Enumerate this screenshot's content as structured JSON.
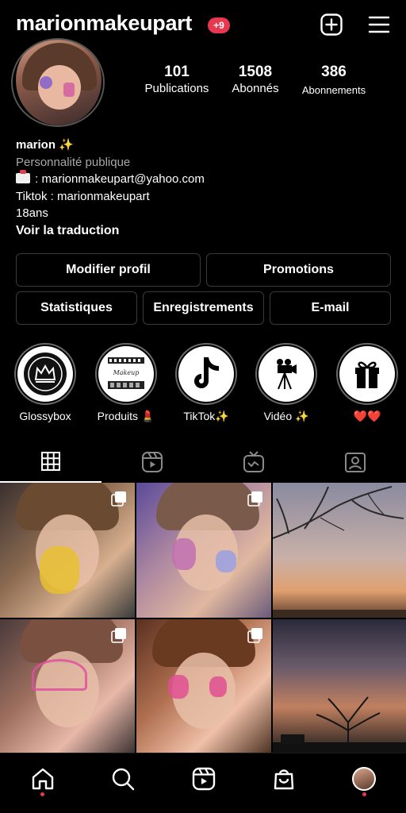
{
  "header": {
    "username": "marionmakeupart",
    "notification_badge": "+9",
    "icons": [
      "add-post-icon",
      "menu-icon"
    ]
  },
  "stats": {
    "posts": {
      "value": "101",
      "label": "Publications"
    },
    "followers": {
      "value": "1508",
      "label": "Abonnés"
    },
    "following": {
      "value": "386",
      "label": "Abonnements"
    }
  },
  "bio": {
    "name": "marion ✨",
    "category": "Personnalité publique",
    "email_line": ": marionmakeupart@yahoo.com",
    "tiktok_line": "Tiktok : marionmakeupart",
    "age_line": "18ans",
    "translate_link": "Voir la traduction"
  },
  "buttons": {
    "edit_profile": "Modifier profil",
    "promotions": "Promotions",
    "insights": "Statistiques",
    "saved": "Enregistrements",
    "email": "E-mail"
  },
  "highlights": [
    {
      "label": "Glossybox",
      "icon": "crown-logo-icon"
    },
    {
      "label": "Produits 💄",
      "icon": "makeup-shelf-icon"
    },
    {
      "label": "TikTok✨",
      "icon": "tiktok-icon"
    },
    {
      "label": "Vidéo ✨",
      "icon": "video-camera-icon"
    },
    {
      "label": "❤️❤️",
      "icon": "gift-icon"
    }
  ],
  "profile_tabs": [
    {
      "name": "grid",
      "icon": "grid-icon",
      "active": true
    },
    {
      "name": "reels",
      "icon": "reels-icon",
      "active": false
    },
    {
      "name": "igtv",
      "icon": "igtv-icon",
      "active": false
    },
    {
      "name": "tagged",
      "icon": "tagged-icon",
      "active": false
    }
  ],
  "posts": [
    {
      "subject": "makeup portrait, yellow face paint",
      "multi": true
    },
    {
      "subject": "makeup portrait, blue eye art",
      "multi": true
    },
    {
      "subject": "sunset with bare tree branches",
      "multi": false
    },
    {
      "subject": "makeup portrait, pink heart art",
      "multi": true
    },
    {
      "subject": "makeup portrait, pink hearts",
      "multi": true
    },
    {
      "subject": "sunset with bare tree silhouette",
      "multi": false
    }
  ],
  "bottom_nav": [
    "home-icon",
    "search-icon",
    "reels-icon",
    "shop-icon",
    "profile-avatar"
  ],
  "colors": {
    "background": "#000000",
    "badge": "#e8384f",
    "button_border": "#3a3a3a",
    "secondary_text": "#a8a8a8"
  }
}
